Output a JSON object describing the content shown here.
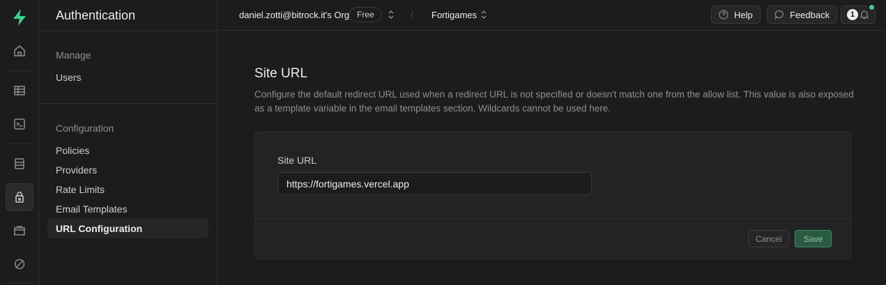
{
  "sidebar": {
    "title": "Authentication",
    "groups": [
      {
        "label": "Manage",
        "items": [
          "Users"
        ]
      },
      {
        "label": "Configuration",
        "items": [
          "Policies",
          "Providers",
          "Rate Limits",
          "Email Templates",
          "URL Configuration"
        ]
      }
    ],
    "active_item": "URL Configuration"
  },
  "topbar": {
    "org": "daniel.zotti@bitrock.it's Org",
    "plan_badge": "Free",
    "project": "Fortigames",
    "help_label": "Help",
    "feedback_label": "Feedback",
    "notification_count": "1"
  },
  "main": {
    "heading": "Site URL",
    "description": "Configure the default redirect URL used when a redirect URL is not specified or doesn't match one from the allow list. This value is also exposed as a template variable in the email templates section. Wildcards cannot be used here.",
    "form": {
      "field_label": "Site URL",
      "field_value": "https://fortigames.vercel.app",
      "cancel_label": "Cancel",
      "save_label": "Save"
    }
  },
  "colors": {
    "brand": "#3ecf8e",
    "background": "#1c1c1c",
    "card": "#232323",
    "save_button": "#2b5a43"
  },
  "icons": [
    "supabase-logo-icon",
    "home-icon",
    "table-editor-icon",
    "sql-editor-icon",
    "database-icon",
    "authentication-icon",
    "storage-icon",
    "realtime-icon",
    "help-circle-icon",
    "feedback-icon",
    "bell-icon",
    "chevron-up-down-icon"
  ]
}
